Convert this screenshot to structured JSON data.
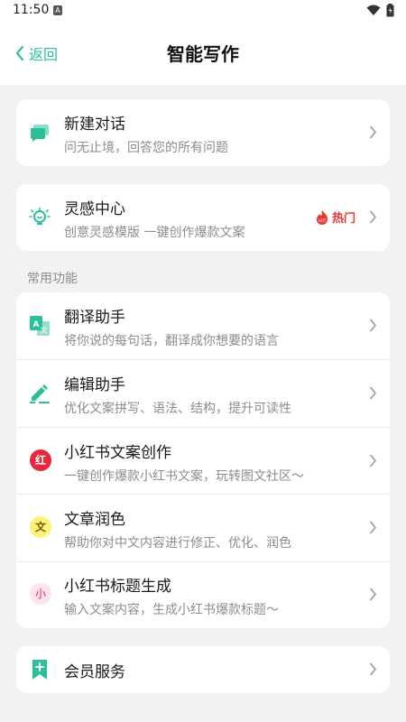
{
  "status": {
    "time": "11:50",
    "notif_icon": "a-icon"
  },
  "nav": {
    "back_label": "返回",
    "title": "智能写作"
  },
  "new_chat": {
    "title": "新建对话",
    "subtitle": "问无止境，回答您的所有问题"
  },
  "inspiration": {
    "title": "灵感中心",
    "subtitle": "创意灵感模版 一键创作爆款文案",
    "badge": "热门"
  },
  "section_label": "常用功能",
  "features": [
    {
      "title": "翻译助手",
      "subtitle": "将你说的每句话，翻译成你想要的语言"
    },
    {
      "title": "编辑助手",
      "subtitle": "优化文案拼写、语法、结构，提升可读性"
    },
    {
      "title": "小红书文案创作",
      "subtitle": "一键创作爆款小红书文案，玩转图文社区～",
      "icon_char": "红"
    },
    {
      "title": "文章润色",
      "subtitle": "帮助你对中文内容进行修正、优化、润色",
      "icon_char": "文"
    },
    {
      "title": "小红书标题生成",
      "subtitle": "输入文案内容，生成小红书爆款标题～",
      "icon_char": "小"
    }
  ],
  "membership": {
    "title": "会员服务"
  },
  "colors": {
    "accent": "#2bbf9a",
    "hot": "#e8382f"
  }
}
